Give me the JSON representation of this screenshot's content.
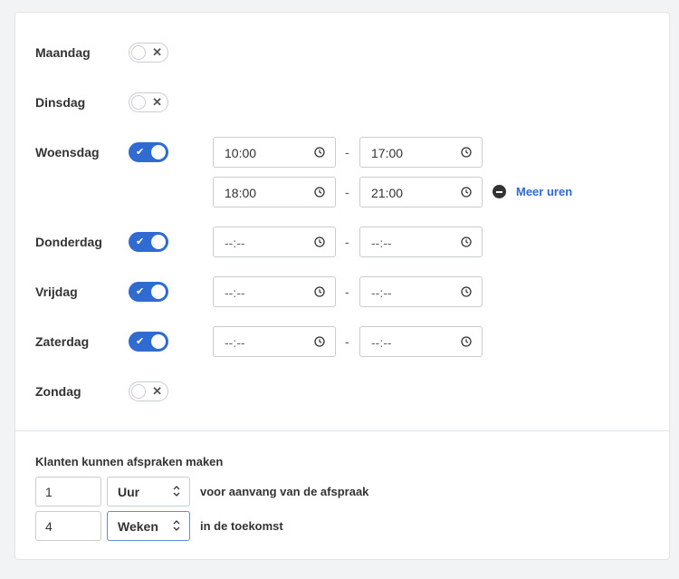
{
  "days": [
    {
      "label": "Maandag",
      "enabled": false
    },
    {
      "label": "Dinsdag",
      "enabled": false
    },
    {
      "label": "Woensdag",
      "enabled": true
    },
    {
      "label": "Donderdag",
      "enabled": true
    },
    {
      "label": "Vrijdag",
      "enabled": true
    },
    {
      "label": "Zaterdag",
      "enabled": true
    },
    {
      "label": "Zondag",
      "enabled": false
    }
  ],
  "toggle_marks": {
    "on": "✔",
    "off": "✕"
  },
  "time_slots": {
    "woensdag": [
      {
        "start": "10:00",
        "end": "17:00"
      },
      {
        "start": "18:00",
        "end": "21:00"
      }
    ],
    "donderdag": [
      {
        "start": "--:--",
        "end": "--:--"
      }
    ],
    "vrijdag": [
      {
        "start": "--:--",
        "end": "--:--"
      }
    ],
    "zaterdag": [
      {
        "start": "--:--",
        "end": "--:--"
      }
    ]
  },
  "separator": "-",
  "more_hours_label": "Meer uren",
  "booking": {
    "title": "Klanten kunnen afspraken maken",
    "before": {
      "value": "1",
      "unit": "Uur",
      "text": "voor aanvang van de afspraak"
    },
    "future": {
      "value": "4",
      "unit": "Weken",
      "text": "in de toekomst"
    }
  },
  "colors": {
    "accent": "#2f6bd0"
  },
  "icons": {
    "clock": "clock-icon",
    "remove": "minus-circle-icon",
    "select": "chevron-updown-icon"
  }
}
